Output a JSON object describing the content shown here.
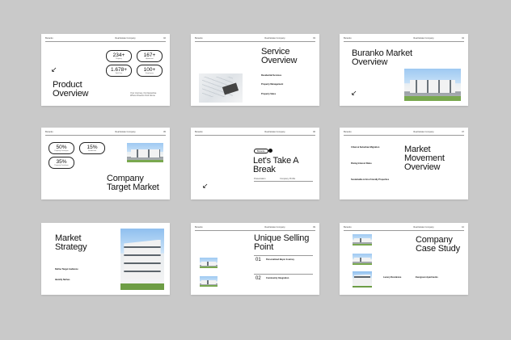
{
  "slides": [
    {
      "id": "product-overview",
      "header": {
        "brand": "Buranko",
        "mid": "Real Estate Company",
        "num": "02"
      },
      "title": "Product Overview",
      "stats": [
        {
          "value": "234+",
          "label": "Property"
        },
        {
          "value": "167+",
          "label": "Apartment"
        },
        {
          "value": "1.678+",
          "label": "Sold Year"
        },
        {
          "value": "100+",
          "label": "Employees"
        }
      ],
      "caption": "Your Journey, Our Expertise Where Dreams Find Home"
    },
    {
      "id": "service-overview",
      "header": {
        "brand": "Buranko",
        "mid": "Real Estate Company",
        "num": "03"
      },
      "title": "Service Overview",
      "items": [
        "Residential Services",
        "Property Management",
        "Property Sales"
      ]
    },
    {
      "id": "market-overview",
      "header": {
        "brand": "Buranko",
        "mid": "Real Estate Company",
        "num": "04"
      },
      "title": "Buranko Market Overview"
    },
    {
      "id": "target-market",
      "header": {
        "brand": "Buranko",
        "mid": "Real Estate Company",
        "num": "05"
      },
      "title": "Company Target Market",
      "stats": [
        {
          "value": "50%",
          "label": "Property Developer"
        },
        {
          "value": "15%",
          "label": "Residential"
        },
        {
          "value": "35%",
          "label": "Property Developer"
        }
      ]
    },
    {
      "id": "break",
      "header": {
        "brand": "Buranko",
        "mid": "Real Estate Company",
        "num": "06"
      },
      "title": "Let's Take A Break",
      "button": "Buranko",
      "footer_left": "Presentation",
      "footer_right": "Company Profile"
    },
    {
      "id": "market-movement",
      "header": {
        "brand": "Buranko",
        "mid": "Real Estate Company",
        "num": "07"
      },
      "title": "Market Movement Overview",
      "items": [
        "Urban & Suburban Migration",
        "Rising Interest Rates",
        "Sustainable & Eco-Friendly Properties"
      ]
    },
    {
      "id": "market-strategy",
      "header": {
        "brand": "",
        "mid": "",
        "num": ""
      },
      "title": "Market Strategy",
      "items": [
        "Define Target Audience",
        "Identify Niches"
      ]
    },
    {
      "id": "usp",
      "header": {
        "brand": "Buranko",
        "mid": "Real Estate Company",
        "num": "09"
      },
      "title": "Unique Selling Point",
      "points": [
        {
          "num": "01",
          "label": "Personalized Buyer Journey"
        },
        {
          "num": "02",
          "label": "Community Integration"
        }
      ]
    },
    {
      "id": "case-study",
      "header": {
        "brand": "Buranko",
        "mid": "Real Estate Company",
        "num": "10"
      },
      "title": "Company Case Study",
      "items": [
        "Luxury Residence",
        "Evergreen Apartments"
      ]
    }
  ]
}
